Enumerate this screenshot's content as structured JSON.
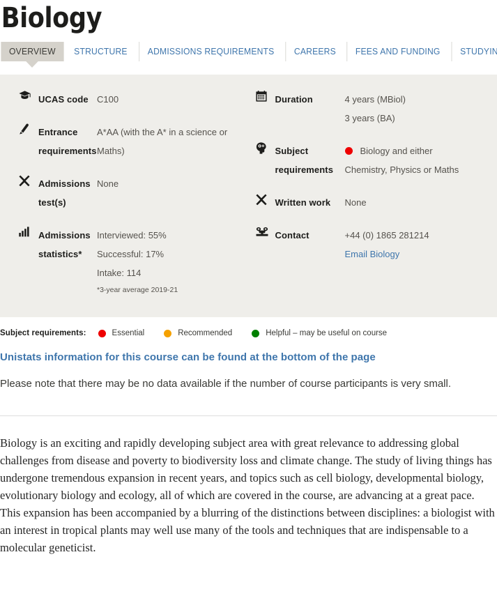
{
  "header": {
    "title": "Biology"
  },
  "tabs": [
    {
      "label": "OVERVIEW",
      "active": true
    },
    {
      "label": "STRUCTURE",
      "active": false
    },
    {
      "label": "ADMISSIONS REQUIREMENTS",
      "active": false
    },
    {
      "label": "CAREERS",
      "active": false
    },
    {
      "label": "FEES AND FUNDING",
      "active": false
    },
    {
      "label": "STUDYING AT OXFORD",
      "active": false
    }
  ],
  "info": {
    "left": [
      {
        "icon": "graduation-cap-icon",
        "label": "UCAS code",
        "lines": [
          "C100"
        ]
      },
      {
        "icon": "pencil-icon",
        "label": "Entrance requirements",
        "lines": [
          "A*AA (with the A* in a science or Maths)"
        ]
      },
      {
        "icon": "cross-icon",
        "label": "Admissions test(s)",
        "lines": [
          "None"
        ]
      },
      {
        "icon": "bar-chart-icon",
        "label": "Admissions statistics*",
        "lines": [
          "Interviewed: 55%",
          "Successful: 17%",
          "Intake: 114"
        ],
        "footnote": "*3-year average 2019-21"
      }
    ],
    "right": [
      {
        "icon": "calendar-icon",
        "label": "Duration",
        "lines": [
          "4 years (MBiol)",
          "3 years (BA)"
        ]
      },
      {
        "icon": "head-brain-icon",
        "label": "Subject requirements",
        "dot_color": "#ee0000",
        "lines": [
          "Biology and either",
          "Chemistry, Physics or Maths"
        ]
      },
      {
        "icon": "cross-icon",
        "label": "Written work",
        "lines": [
          "None"
        ]
      },
      {
        "icon": "telephone-icon",
        "label": "Contact",
        "lines": [
          "+44 (0) 1865 281214"
        ],
        "link": "Email Biology"
      }
    ]
  },
  "legend": {
    "title": "Subject requirements:",
    "items": [
      {
        "color": "#ee0000",
        "label": "Essential"
      },
      {
        "color": "#f5a100",
        "label": "Recommended"
      },
      {
        "color": "#008000",
        "label": "Helpful – may be useful on course"
      }
    ]
  },
  "unistats": {
    "link_text": "Unistats information for this course can be found at the bottom of the page",
    "note": "Please note that there may be no data available if the number of course participants is very small."
  },
  "body": {
    "paragraph": "Biology is an exciting and rapidly developing subject area with great relevance to addressing global challenges from disease and poverty to biodiversity loss and climate change. The study of living things has undergone tremendous expansion in recent years, and topics such as cell biology, developmental biology, evolutionary biology and ecology, all of which are covered in the course, are advancing at a great pace. This expansion has been accompanied by a blurring of the distinctions between disciplines: a biologist with an interest in tropical plants may well use many of the tools and techniques that are indispensable to a molecular geneticist."
  },
  "colors": {
    "panel_background": "#efeeea",
    "active_tab_background": "#d5d2cb",
    "link_blue": "#3f76ac",
    "label_dark": "#1d1d1b",
    "value_grey": "#55524d",
    "essential_red": "#ee0000",
    "recommended_orange": "#f5a100",
    "helpful_green": "#008000"
  }
}
